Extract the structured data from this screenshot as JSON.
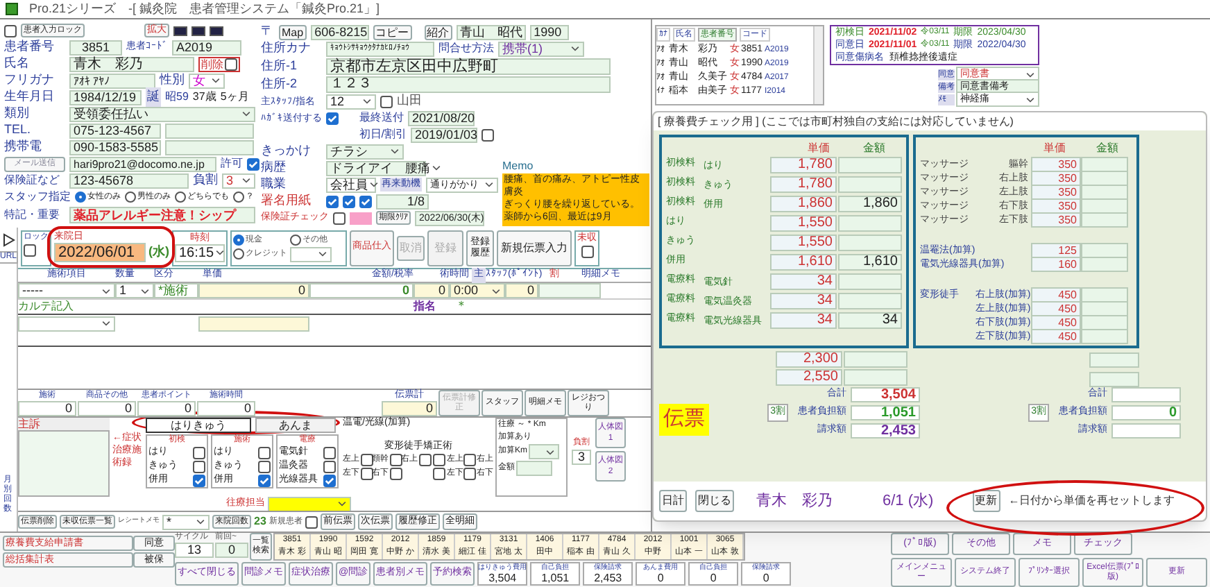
{
  "window": {
    "title": "Pro.21シリーズ　-[ 鍼灸院　患者管理システム「鍼灸Pro.21」]"
  },
  "patient": {
    "input_lock": {
      "label": "患者入力ロック",
      "checked": false
    },
    "enlarge_button": "拡大",
    "number": {
      "label": "患者番号",
      "value": "3851"
    },
    "code": {
      "label": "患者ｺｰﾄﾞ",
      "value": "A2019"
    },
    "name": {
      "label": "氏名",
      "value": "青木　彩乃"
    },
    "delete": {
      "label": "削除",
      "checked": false
    },
    "kana": {
      "label": "フリガナ",
      "value": "ｱｵｷ ｱﾔﾉ"
    },
    "sex": {
      "label": "性別",
      "value": "女"
    },
    "birth": {
      "label": "生年月日",
      "value": "1984/12/19",
      "badge": "誕",
      "era": "昭59",
      "age": "37歳",
      "months": "5ヶ月"
    },
    "category": {
      "label": "類別",
      "value": "受領委任払い"
    },
    "tel": {
      "label": "TEL.",
      "value": "075-123-4567"
    },
    "mobile": {
      "label": "携帯電",
      "value": "090-1583-5585"
    },
    "mail_button": "メール送信",
    "mail": "hari9pro21@docomo.ne.jp",
    "mail_permit": {
      "label": "許可",
      "checked": true
    },
    "insurance": {
      "label": "保険証など",
      "value": "123-45678",
      "ratio_label": "負割",
      "ratio": "3"
    },
    "staff_pref": {
      "label": "スタッフ指定",
      "options": [
        {
          "label": "女性のみ",
          "selected": true
        },
        {
          "label": "男性のみ",
          "selected": false
        },
        {
          "label": "どちらでも",
          "selected": false
        },
        {
          "label": "？",
          "selected": false
        }
      ]
    },
    "notes": {
      "label": "特記・重要",
      "value": "薬品アレルギー注意！シップ"
    }
  },
  "address": {
    "zip_label": "〒",
    "map_button": "Map",
    "zip": "606-8215",
    "copy_button": "コピー",
    "referral": {
      "label": "紹介",
      "name": "青山　昭代",
      "number": "1990"
    },
    "contact": {
      "label": "問合せ方法",
      "value": "携帯(1)"
    },
    "kana": {
      "label": "住所カナ",
      "value": "ｷｮｳﾄｼｻｷｮｳｸﾀﾅｶﾋﾛﾉﾁｮｳ"
    },
    "line1": {
      "label": "住所-1",
      "value": "京都市左京区田中広野町"
    },
    "line2": {
      "label": "住所-2",
      "value": "１２３"
    },
    "staff": {
      "label": "主ｽﾀｯﾌ/指名",
      "value": "12",
      "nominee_label": "山田",
      "nominee_checked": false
    },
    "postcard": {
      "label": "ﾊｶﾞｷ送付する",
      "checked": true,
      "last_label": "最終送付",
      "last": "2021/08/20"
    },
    "first": {
      "label": "初日/割引",
      "value": "2019/01/03",
      "checked": false
    },
    "trigger": {
      "label": "きっかけ",
      "value": "チラシ"
    },
    "history": {
      "label": "病歴",
      "value": "ドライアイ　腰痛"
    },
    "job": {
      "label": "職業",
      "value": "会社員",
      "motive_label": "再来動機",
      "motive": "通りがかり"
    },
    "signature": {
      "label": "署名用紙",
      "checks": [
        true,
        true,
        true
      ],
      "count": "1/8"
    },
    "insurance_check": {
      "label": "保険証チェック",
      "checked": false,
      "clear_button": "期限ｸﾘｱ",
      "date": "2022/06/30(木)"
    },
    "memo": {
      "label": "Memo",
      "lines": [
        "腰痛、首の痛み、アトピー性皮膚炎",
        "ぎっくり腰を繰り返している。",
        "薬師から6回、最近は9月"
      ]
    }
  },
  "patient_list": {
    "columns": [
      "ｶﾅ",
      "氏名",
      "患者番号",
      "コード"
    ],
    "rows": [
      {
        "kana": "ｱｵ",
        "name": "青木　彩乃",
        "sex": "女",
        "number": "3851",
        "code": "A2019"
      },
      {
        "kana": "ｱｵ",
        "name": "青山　昭代",
        "sex": "女",
        "number": "1990",
        "code": "A2019"
      },
      {
        "kana": "ｱｵ",
        "name": "青山　久美子",
        "sex": "女",
        "number": "4784",
        "code": "A2017"
      },
      {
        "kana": "ｲﾅ",
        "name": "稲本　由美子",
        "sex": "女",
        "number": "1177",
        "code": "I2014"
      }
    ]
  },
  "consent": {
    "rows": [
      {
        "label": "初検日",
        "date": "2021/11/02",
        "era": "令03/11",
        "limit_label": "期限",
        "limit": "2023/04/30"
      },
      {
        "label": "同意日",
        "date": "2021/11/01",
        "era": "令03/11",
        "limit_label": "期限",
        "limit": "2022/04/30"
      }
    ],
    "disease_label": "同意傷病名",
    "disease": "頚椎捻挫後遺症",
    "fields": [
      {
        "label": "同意",
        "value": "同意書"
      },
      {
        "label": "備考",
        "value": "同意書備考"
      },
      {
        "label": "ﾒﾓ",
        "value": "神経痛"
      }
    ]
  },
  "visit": {
    "lock": {
      "label": "ロック",
      "checked": false
    },
    "date_label": "来院日",
    "date": "2022/06/01",
    "weekday": "(水)",
    "time_label": "時刻",
    "time": "16:15",
    "payment": [
      {
        "label": "現金",
        "selected": true
      },
      {
        "label": "その他",
        "selected": false
      },
      {
        "label": "クレジット",
        "selected": false
      }
    ],
    "stock_button": "商品仕入",
    "cancel_button": "取消",
    "register_button": "登録",
    "history_button": "登録履歴",
    "new_button": "新規伝票入力",
    "unpaid": {
      "label": "未収",
      "checked": false
    }
  },
  "side_strip": [
    "URL",
    "月別回数"
  ],
  "slip_table": {
    "columns": [
      "施術項目",
      "数量",
      "区分",
      "単価",
      "金額/税率",
      "術時間",
      "主",
      "ｽﾀｯﾌ(ﾎﾟｲﾝﾄ)",
      "割",
      "明細メモ"
    ],
    "rows": [
      {
        "item": "-----",
        "qty": "1",
        "class": "*施術",
        "price": "0",
        "amount": "0",
        "time": "0",
        "time2": "0:00",
        "point": "0",
        "note_label": "カルテ記入",
        "nominee": "指名",
        "staff2": "＊"
      }
    ]
  },
  "totals": [
    {
      "label": "施術",
      "value": "0"
    },
    {
      "label": "商品その他",
      "value": "0"
    },
    {
      "label": "患者ポイント",
      "value": "0"
    },
    {
      "label": "施術時間",
      "value": "0"
    }
  ],
  "slip_total": {
    "label": "伝票計",
    "value": "0"
  },
  "total_buttons": [
    {
      "label": "伝票計修正",
      "disabled": true
    },
    {
      "label": "スタッフ",
      "disabled": false
    },
    {
      "label": "明細メモ",
      "disabled": false
    },
    {
      "label": "レジおつり",
      "disabled": false
    }
  ],
  "treatment": {
    "complaint_label": "主訴",
    "side_label": "←症状治療施術録",
    "tabs": [
      {
        "label": "はりきゅう",
        "selected": true
      },
      {
        "label": "あんま",
        "selected": false
      }
    ],
    "groups": [
      {
        "title": "初検",
        "items": [
          {
            "label": "はり",
            "checked": false
          },
          {
            "label": "きゅう",
            "checked": false
          },
          {
            "label": "併用",
            "checked": true
          }
        ]
      },
      {
        "title": "施術",
        "items": [
          {
            "label": "はり",
            "checked": false
          },
          {
            "label": "きゅう",
            "checked": false
          },
          {
            "label": "併用",
            "checked": true
          }
        ]
      },
      {
        "title": "電療",
        "items": [
          {
            "label": "電気針",
            "checked": false
          },
          {
            "label": "温灸器",
            "checked": false
          },
          {
            "label": "光線器具",
            "checked": true
          }
        ]
      }
    ],
    "warm_label": "温電/光線(加算)",
    "correction_label": "変形徒手矯正術",
    "massage": [
      {
        "label": "左上",
        "checked": false
      },
      {
        "label": "頸幹",
        "checked": false
      },
      {
        "label": "右上",
        "checked": false
      },
      {
        "label": "左下",
        "checked": false
      },
      {
        "label": "右下",
        "checked": false
      }
    ],
    "correction": [
      {
        "label": "左上",
        "checked": false
      },
      {
        "label": "右上",
        "checked": false
      },
      {
        "label": "左下",
        "checked": false
      },
      {
        "label": "右下",
        "checked": false
      }
    ],
    "visit_label": "往療 ～ * Km",
    "extra_label": "加算あり",
    "extra_km_label": "加算Km",
    "amount_label": "金額",
    "ratio_label": "負割",
    "ratio": "3",
    "body_buttons": [
      "人体図1",
      "人体図2"
    ],
    "visit_staff_label": "往療担当"
  },
  "slip_strip": {
    "delete_button": "伝票削除",
    "unpaid_button": "未収伝票一覧",
    "receipt_label": "レシートメモ",
    "receipt": "*",
    "visits_label": "来院回数",
    "visits": "23",
    "new_label": "新規患者",
    "new_checked": false,
    "buttons": [
      "前伝票",
      "次伝票",
      "履歴修正",
      "全明細"
    ]
  },
  "bottom": {
    "forms": [
      "療養費支給申請書",
      "総括集計表"
    ],
    "cycle_label": "サイクル",
    "cycle": "13",
    "prev_label": "前回~",
    "prev": "0",
    "list_button": "一覧検索",
    "recent": [
      {
        "number": "3851",
        "name": "青木 彩"
      },
      {
        "number": "1990",
        "name": "青山 昭"
      },
      {
        "number": "1592",
        "name": "岡田 寛"
      },
      {
        "number": "2012",
        "name": "中野 か"
      },
      {
        "number": "1859",
        "name": "清水 美"
      },
      {
        "number": "1179",
        "name": "細江 佳"
      },
      {
        "number": "3131",
        "name": "宮地 太"
      },
      {
        "number": "1406",
        "name": "田中"
      },
      {
        "number": "1177",
        "name": "稲本 由"
      },
      {
        "number": "4784",
        "name": "青山 久"
      },
      {
        "number": "2012",
        "name": "中野"
      },
      {
        "number": "1001",
        "name": "山本 一"
      },
      {
        "number": "3065",
        "name": "山本 敦"
      }
    ],
    "small_buttons": [
      "同意",
      "被保"
    ],
    "buttons": [
      "すべて閉じる",
      "問診メモ",
      "症状治療",
      "@問診",
      "患者別メモ",
      "予約検索"
    ],
    "costs": [
      {
        "label": "はりきゅう費用",
        "value": "3,504"
      },
      {
        "label": "自己負担",
        "value": "1,051"
      },
      {
        "label": "保険請求",
        "value": "2,453"
      },
      {
        "label": "あんま費用",
        "value": "0"
      },
      {
        "label": "自己負担",
        "value": "0"
      },
      {
        "label": "保険請求",
        "value": "0"
      }
    ],
    "top_buttons": [
      "(ﾌﾟﾛ版)",
      "その他",
      "メモ",
      "チェック"
    ],
    "menu_buttons": [
      "メインメニュー",
      "システム終了",
      "ﾌﾟﾘﾝﾀｰ選択",
      "Excel伝票(ﾌﾟﾛ版)",
      "更新"
    ]
  },
  "check_dialog": {
    "title": "[ 療養費チェック用 ] (ここでは市町村独自の支給には対応していません)",
    "left_columns": [
      "単価",
      "金額"
    ],
    "left": [
      {
        "label": "初検料",
        "sub": "はり",
        "price": "1,780"
      },
      {
        "label": "初検料",
        "sub": "きゅう",
        "price": "1,780"
      },
      {
        "label": "初検料",
        "sub": "併用",
        "price": "1,860",
        "amount": "1,860"
      },
      {
        "label": "はり",
        "price": "1,550"
      },
      {
        "label": "きゅう",
        "price": "1,550"
      },
      {
        "label": "併用",
        "price": "1,610",
        "amount": "1,610"
      },
      {
        "label": "電療料",
        "sub": "電気針",
        "price": "34"
      },
      {
        "label": "電療料",
        "sub": "電気温灸器",
        "price": "34"
      },
      {
        "label": "電療料",
        "sub": "電気光線器具",
        "price": "34",
        "amount": "34"
      }
    ],
    "right_columns": [
      "単価",
      "金額"
    ],
    "right_sections": [
      [
        {
          "label": "マッサージ",
          "sub": "軀幹",
          "price": "350"
        },
        {
          "label": "マッサージ",
          "sub": "右上肢",
          "price": "350"
        },
        {
          "label": "マッサージ",
          "sub": "左上肢",
          "price": "350"
        },
        {
          "label": "マッサージ",
          "sub": "右下肢",
          "price": "350"
        },
        {
          "label": "マッサージ",
          "sub": "左下肢",
          "price": "350"
        }
      ],
      [
        {
          "label": "温罨法(加算)",
          "price": "125"
        },
        {
          "label": "電気光線器具(加算)",
          "price": "160"
        }
      ],
      [
        {
          "label": "変形徒手",
          "sub": "右上肢(加算)",
          "price": "450"
        },
        {
          "sub": "左上肢(加算)",
          "price": "450"
        },
        {
          "sub": "右下肢(加算)",
          "price": "450"
        },
        {
          "sub": "左下肢(加算)",
          "price": "450"
        }
      ]
    ],
    "extra_prices": [
      "2,300",
      "2,550"
    ],
    "summaries": [
      {
        "total_label": "合計",
        "total": "3,504",
        "ratio": "3割",
        "burden_label": "患者負担額",
        "burden": "1,051",
        "claim_label": "請求額",
        "claim": "2,453"
      },
      {
        "total_label": "合計",
        "ratio": "3割",
        "burden_label": "患者負担額",
        "burden": "0",
        "claim_label": "請求額"
      }
    ],
    "slip_badge": "伝票",
    "daily_button": "日計",
    "close_button": "閉じる",
    "patient": "青木　彩乃",
    "date": "6/1 (水)",
    "update_button": "更新",
    "hint": "←日付から単価を再セットします"
  }
}
